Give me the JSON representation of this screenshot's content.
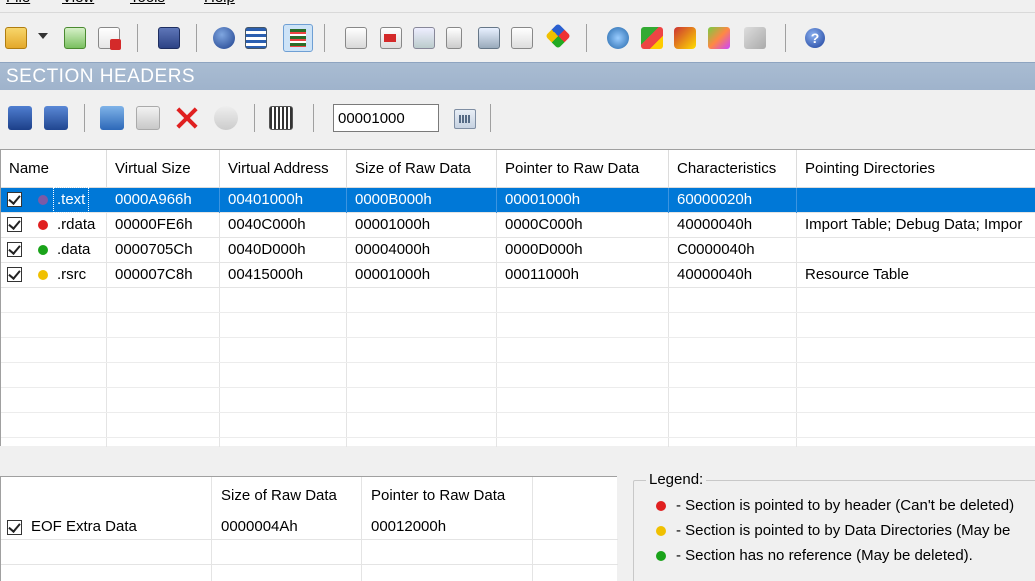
{
  "menu": [
    "File",
    "View",
    "Tools",
    "Help"
  ],
  "section_header": {
    "title": "SECTION HEADERS"
  },
  "toolbar": {
    "icons": [
      "open-folder-icon",
      "dropdown-arrow-icon",
      "refresh-icon",
      "close-file-icon",
      "save-icon",
      "info-icon",
      "tree-view-icon",
      "list-view-icon",
      "add-section-icon",
      "import-icon",
      "export-icon",
      "edit-icon",
      "disk-icon",
      "settings-icon",
      "compare-icon",
      "plugin-icon",
      "tools-icon",
      "tools2-icon",
      "magic-icon",
      "pe-icon",
      "help-icon"
    ]
  },
  "section_toolbar": {
    "rva_value": "00001000"
  },
  "sections_table": {
    "columns": [
      "Name",
      "Virtual Size",
      "Virtual Address",
      "Size of Raw Data",
      "Pointer to Raw Data",
      "Characteristics",
      "Pointing Directories"
    ],
    "rows": [
      {
        "checked": true,
        "dot_color": "#7b5aa6",
        "name": ".text",
        "virtual_size": "0000A966h",
        "virtual_address": "00401000h",
        "size_raw": "0000B000h",
        "ptr_raw": "00001000h",
        "characteristics": "60000020h",
        "directories": "",
        "selected": true
      },
      {
        "checked": true,
        "dot_color": "#e02020",
        "name": ".rdata",
        "virtual_size": "00000FE6h",
        "virtual_address": "0040C000h",
        "size_raw": "00001000h",
        "ptr_raw": "0000C000h",
        "characteristics": "40000040h",
        "directories": "Import Table; Debug Data; Impor",
        "selected": false
      },
      {
        "checked": true,
        "dot_color": "#1aa31a",
        "name": ".data",
        "virtual_size": "0000705Ch",
        "virtual_address": "0040D000h",
        "size_raw": "00004000h",
        "ptr_raw": "0000D000h",
        "characteristics": "C0000040h",
        "directories": "",
        "selected": false
      },
      {
        "checked": true,
        "dot_color": "#f0c000",
        "name": ".rsrc",
        "virtual_size": "000007C8h",
        "virtual_address": "00415000h",
        "size_raw": "00001000h",
        "ptr_raw": "00011000h",
        "characteristics": "40000040h",
        "directories": "Resource Table",
        "selected": false
      }
    ]
  },
  "eof_table": {
    "columns": [
      "",
      "Size of Raw Data",
      "Pointer to Raw Data"
    ],
    "row": {
      "checked": true,
      "label": "EOF Extra Data",
      "size_raw": "0000004Ah",
      "ptr_raw": "00012000h"
    }
  },
  "legend": {
    "title": "Legend:",
    "items": [
      {
        "color": "#e02020",
        "text": "- Section is pointed to by header (Can't be deleted)"
      },
      {
        "color": "#f0c000",
        "text": "- Section is pointed to by Data Directories (May be"
      },
      {
        "color": "#1aa31a",
        "text": "- Section has no reference (May be deleted)."
      }
    ]
  }
}
